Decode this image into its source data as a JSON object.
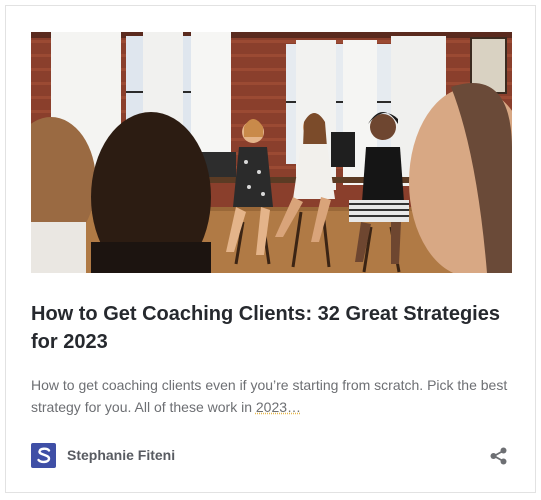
{
  "post": {
    "image_alt": "Group of women sitting on stools in a brick-walled loft during a coaching session",
    "title": "How to Get Coaching Clients: 32 Great Strategies for 2023",
    "excerpt_main": "How to get coaching clients even if you’re starting from scratch. Pick the best strategy for you. All of these work in ",
    "excerpt_trail": "2023…",
    "author": {
      "name": "Stephanie Fiteni",
      "avatar_letter": "S"
    },
    "share_icon": "share-icon"
  },
  "colors": {
    "title": "#26292e",
    "excerpt": "#6d6f73",
    "author": "#585b61",
    "avatar_bg": "#3f4fa6",
    "border": "#e2e2e2"
  }
}
